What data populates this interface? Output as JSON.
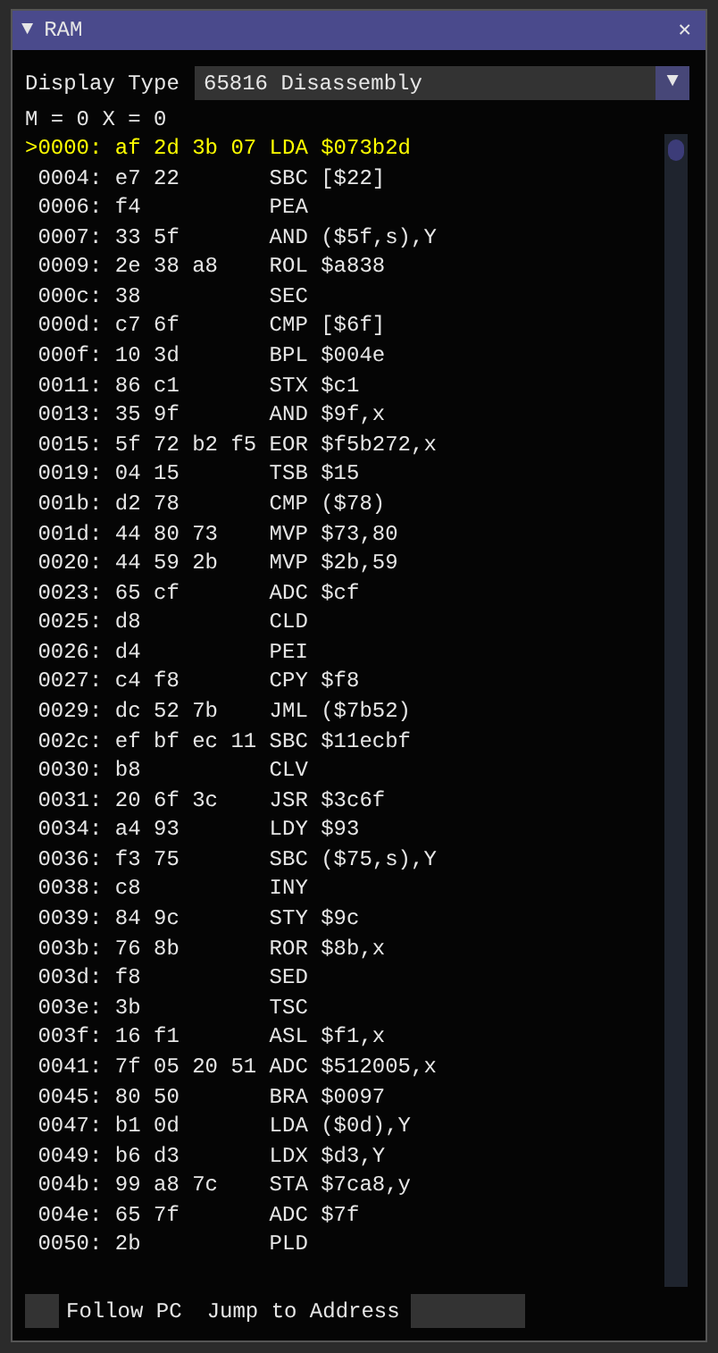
{
  "window": {
    "title": "RAM",
    "collapse_glyph": "▼",
    "close_glyph": "✕"
  },
  "display_type": {
    "label": "Display Type",
    "value": "65816 Disassembly",
    "arrow_glyph": "▼"
  },
  "flags": "M = 0 X = 0",
  "rows": [
    {
      "marker": ">",
      "address": "0000:",
      "bytes": "af 2d 3b 07",
      "instruction": "LDA $073b2d",
      "selected": true
    },
    {
      "address": "0004:",
      "bytes": "e7 22",
      "instruction": "SBC [$22]",
      "selected": false
    },
    {
      "address": "0006:",
      "bytes": "f4",
      "instruction": "PEA",
      "selected": false
    },
    {
      "address": "0007:",
      "bytes": "33 5f",
      "instruction": "AND ($5f,s),Y",
      "selected": false
    },
    {
      "address": "0009:",
      "bytes": "2e 38 a8",
      "instruction": "ROL $a838",
      "selected": false
    },
    {
      "address": "000c:",
      "bytes": "38",
      "instruction": "SEC",
      "selected": false
    },
    {
      "address": "000d:",
      "bytes": "c7 6f",
      "instruction": "CMP [$6f]",
      "selected": false
    },
    {
      "address": "000f:",
      "bytes": "10 3d",
      "instruction": "BPL $004e",
      "selected": false
    },
    {
      "address": "0011:",
      "bytes": "86 c1",
      "instruction": "STX $c1",
      "selected": false
    },
    {
      "address": "0013:",
      "bytes": "35 9f",
      "instruction": "AND $9f,x",
      "selected": false
    },
    {
      "address": "0015:",
      "bytes": "5f 72 b2 f5",
      "instruction": "EOR $f5b272,x",
      "selected": false
    },
    {
      "address": "0019:",
      "bytes": "04 15",
      "instruction": "TSB $15",
      "selected": false
    },
    {
      "address": "001b:",
      "bytes": "d2 78",
      "instruction": "CMP ($78)",
      "selected": false
    },
    {
      "address": "001d:",
      "bytes": "44 80 73",
      "instruction": "MVP $73,80",
      "selected": false
    },
    {
      "address": "0020:",
      "bytes": "44 59 2b",
      "instruction": "MVP $2b,59",
      "selected": false
    },
    {
      "address": "0023:",
      "bytes": "65 cf",
      "instruction": "ADC $cf",
      "selected": false
    },
    {
      "address": "0025:",
      "bytes": "d8",
      "instruction": "CLD",
      "selected": false
    },
    {
      "address": "0026:",
      "bytes": "d4",
      "instruction": "PEI",
      "selected": false
    },
    {
      "address": "0027:",
      "bytes": "c4 f8",
      "instruction": "CPY $f8",
      "selected": false
    },
    {
      "address": "0029:",
      "bytes": "dc 52 7b",
      "instruction": "JML ($7b52)",
      "selected": false
    },
    {
      "address": "002c:",
      "bytes": "ef bf ec 11",
      "instruction": "SBC $11ecbf",
      "selected": false
    },
    {
      "address": "0030:",
      "bytes": "b8",
      "instruction": "CLV",
      "selected": false
    },
    {
      "address": "0031:",
      "bytes": "20 6f 3c",
      "instruction": "JSR $3c6f",
      "selected": false
    },
    {
      "address": "0034:",
      "bytes": "a4 93",
      "instruction": "LDY $93",
      "selected": false
    },
    {
      "address": "0036:",
      "bytes": "f3 75",
      "instruction": "SBC ($75,s),Y",
      "selected": false
    },
    {
      "address": "0038:",
      "bytes": "c8",
      "instruction": "INY",
      "selected": false
    },
    {
      "address": "0039:",
      "bytes": "84 9c",
      "instruction": "STY $9c",
      "selected": false
    },
    {
      "address": "003b:",
      "bytes": "76 8b",
      "instruction": "ROR $8b,x",
      "selected": false
    },
    {
      "address": "003d:",
      "bytes": "f8",
      "instruction": "SED",
      "selected": false
    },
    {
      "address": "003e:",
      "bytes": "3b",
      "instruction": "TSC",
      "selected": false
    },
    {
      "address": "003f:",
      "bytes": "16 f1",
      "instruction": "ASL $f1,x",
      "selected": false
    },
    {
      "address": "0041:",
      "bytes": "7f 05 20 51",
      "instruction": "ADC $512005,x",
      "selected": false
    },
    {
      "address": "0045:",
      "bytes": "80 50",
      "instruction": "BRA $0097",
      "selected": false
    },
    {
      "address": "0047:",
      "bytes": "b1 0d",
      "instruction": "LDA ($0d),Y",
      "selected": false
    },
    {
      "address": "0049:",
      "bytes": "b6 d3",
      "instruction": "LDX $d3,Y",
      "selected": false
    },
    {
      "address": "004b:",
      "bytes": "99 a8 7c",
      "instruction": "STA $7ca8,y",
      "selected": false
    },
    {
      "address": "004e:",
      "bytes": "65 7f",
      "instruction": "ADC $7f",
      "selected": false
    },
    {
      "address": "0050:",
      "bytes": "2b",
      "instruction": "PLD",
      "selected": false
    }
  ],
  "follow_pc": {
    "label": "Follow PC",
    "checked": false
  },
  "jump": {
    "label": "Jump to Address"
  }
}
